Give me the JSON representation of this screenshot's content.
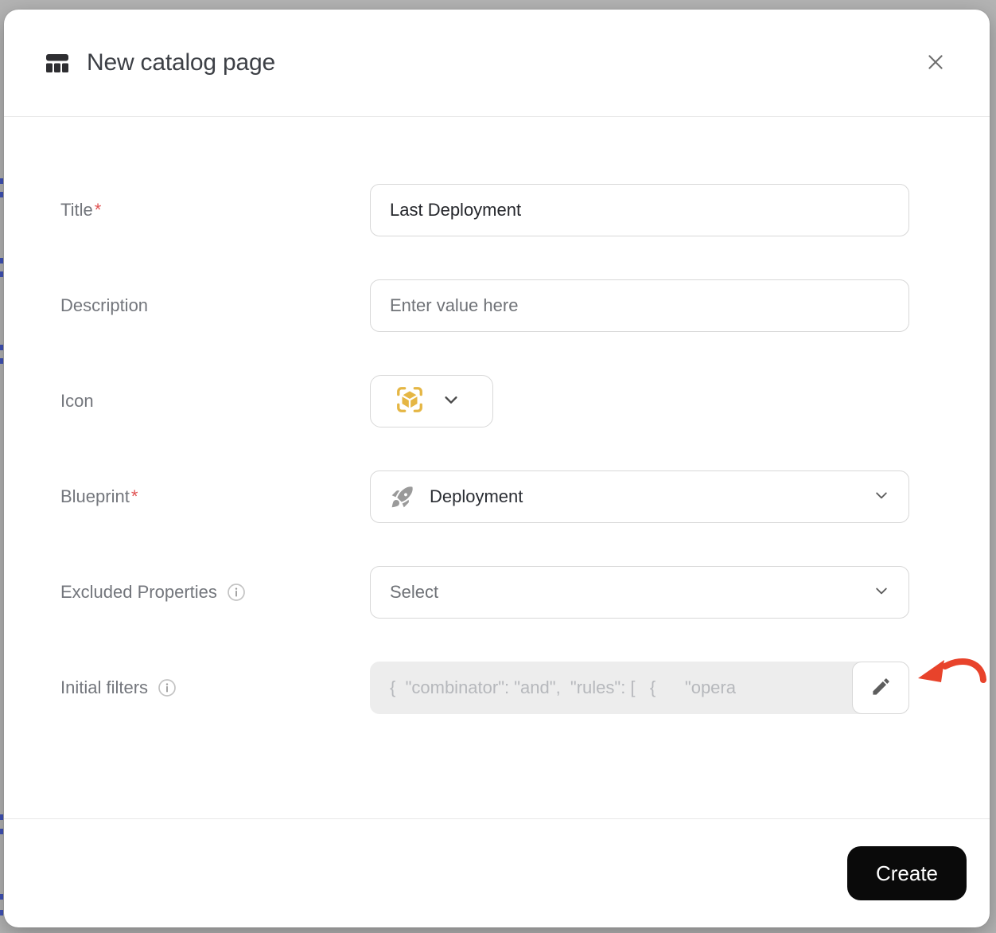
{
  "header": {
    "title": "New catalog page"
  },
  "fields": {
    "title": {
      "label": "Title",
      "required": "*",
      "value": "Last Deployment"
    },
    "description": {
      "label": "Description",
      "placeholder": "Enter value here"
    },
    "icon": {
      "label": "Icon"
    },
    "blueprint": {
      "label": "Blueprint",
      "required": "*",
      "value": "Deployment"
    },
    "excluded_properties": {
      "label": "Excluded Properties",
      "placeholder": "Select"
    },
    "initial_filters": {
      "label": "Initial filters",
      "value": "{  \"combinator\": \"and\",  \"rules\": [   {      \"opera"
    }
  },
  "footer": {
    "create_label": "Create"
  },
  "icons": {
    "catalog": "table-columns-icon",
    "close": "close-icon",
    "icon_field": "cube-scan-icon",
    "blueprint": "rocket-icon",
    "info": "info-circle-icon",
    "chevron": "chevron-down-icon",
    "edit": "pencil-icon",
    "annotation": "red-curved-arrow"
  },
  "colors": {
    "accent_yellow": "#E5B644",
    "annotation_red": "#E8432B",
    "required_red": "#E05252",
    "create_button_bg": "#0A0A0A",
    "disabled_field_bg": "#EDEDED"
  }
}
